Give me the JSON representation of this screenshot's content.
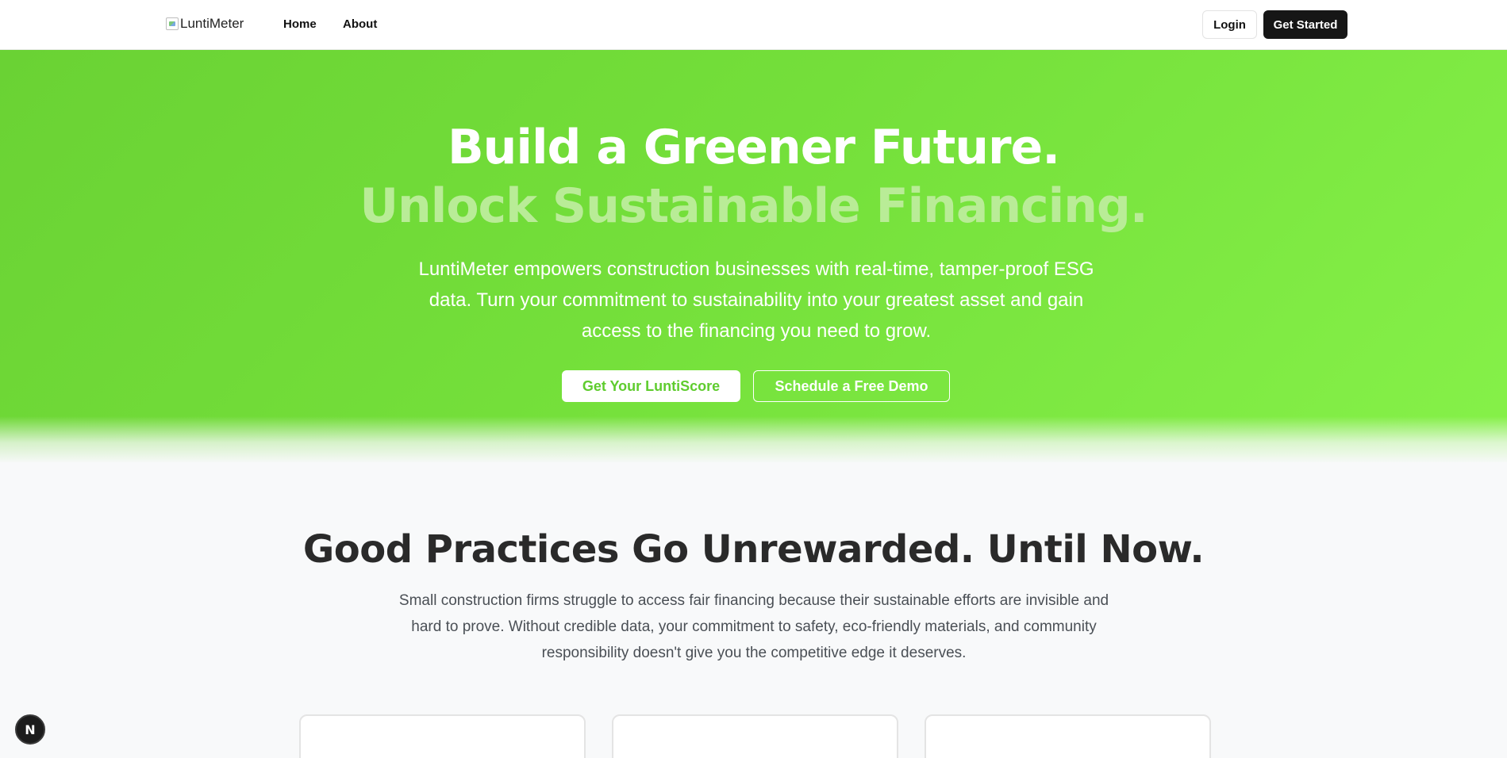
{
  "nav": {
    "logo_alt": "LuntiMeter",
    "links": [
      "Home",
      "About"
    ],
    "login_label": "Login",
    "get_started_label": "Get Started"
  },
  "hero": {
    "title_line1": "Build a Greener Future.",
    "title_line2": "Unlock Sustainable Financing.",
    "description": "LuntiMeter empowers construction businesses with real-time, tamper-proof ESG data. Turn your commitment to sustainability into your greatest asset and gain access to the financing you need to grow.",
    "primary_cta": "Get Your LuntiScore",
    "secondary_cta": "Schedule a Free Demo",
    "colors": {
      "green_start": "#6ad234",
      "green_end": "#86f149",
      "title_accent": "#b9ec97"
    }
  },
  "problem": {
    "title": "Good Practices Go Unrewarded. Until Now.",
    "description": "Small construction firms struggle to access fair financing because their sustainable efforts are invisible and hard to prove. Without credible data, your commitment to safety, eco-friendly materials, and community responsibility doesn't give you the competitive edge it deserves."
  },
  "dev_badge": {
    "letter": "N"
  }
}
